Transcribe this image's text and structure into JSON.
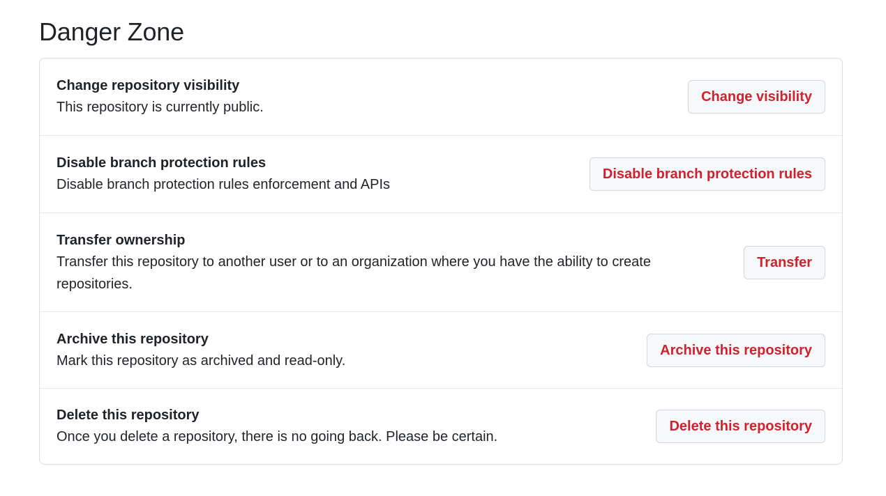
{
  "heading": "Danger Zone",
  "colors": {
    "danger_text": "#cf222e",
    "box_border": "#f1d4d8",
    "row_divider": "#e3e6ea",
    "button_bg": "#f6f8fa"
  },
  "items": [
    {
      "title": "Change repository visibility",
      "description": "This repository is currently public.",
      "button": "Change visibility"
    },
    {
      "title": "Disable branch protection rules",
      "description": "Disable branch protection rules enforcement and APIs",
      "button": "Disable branch protection rules"
    },
    {
      "title": "Transfer ownership",
      "description": "Transfer this repository to another user or to an organization where you have the ability to create repositories.",
      "button": "Transfer"
    },
    {
      "title": "Archive this repository",
      "description": "Mark this repository as archived and read-only.",
      "button": "Archive this repository"
    },
    {
      "title": "Delete this repository",
      "description": "Once you delete a repository, there is no going back. Please be certain.",
      "button": "Delete this repository"
    }
  ]
}
